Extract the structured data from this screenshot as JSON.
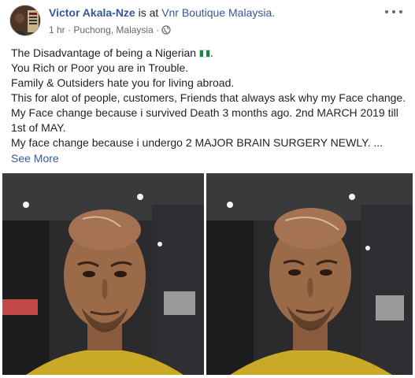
{
  "post": {
    "author": "Victor Akala-Nze",
    "is_at": "is at",
    "place": "Vnr Boutique Malaysia.",
    "time": "1 hr",
    "location": "Puchong, Malaysia",
    "audience_icon": "globe-icon",
    "lines": [
      "The Disadvantage of being a Nigerian",
      "You Rich or Poor you are in Trouble.",
      "Family & Outsiders hate you for living abroad.",
      "This for alot of people, customers, Friends that always ask why my Face change. My Face change because i survived Death 3 months ago. 2nd MARCH 2019 till 1st of MAY.",
      "My face change because i undergo 2 MAJOR BRAIN SURGERY NEWLY. ..."
    ],
    "see_more": "See More",
    "colors": {
      "link": "#365899",
      "text": "#1d2129",
      "meta": "#616770"
    }
  }
}
